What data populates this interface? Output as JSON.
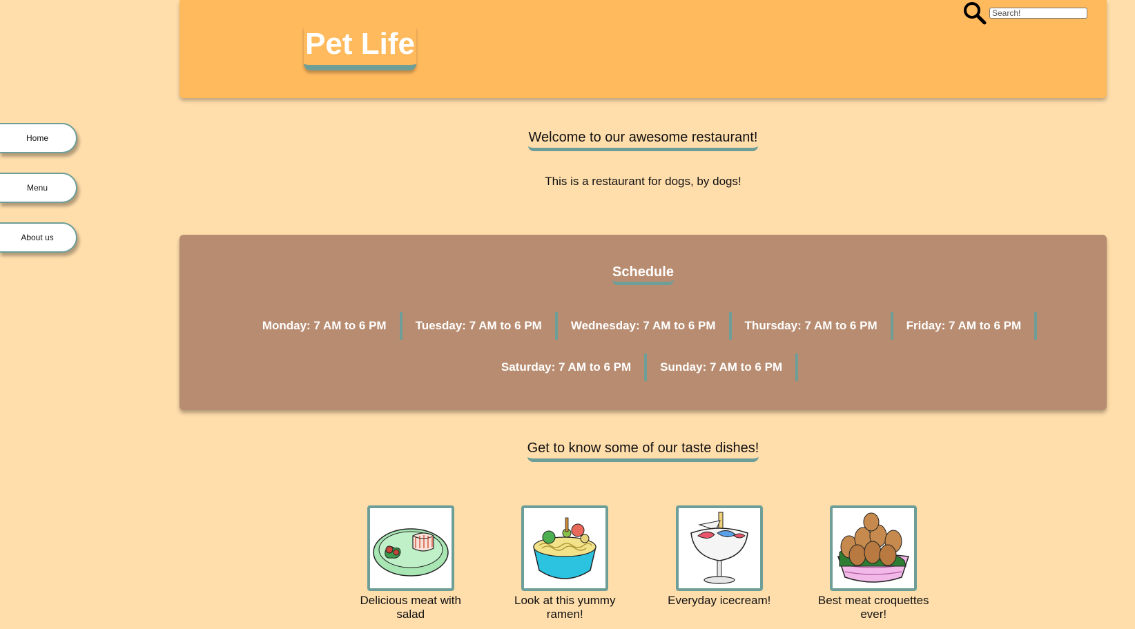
{
  "header": {
    "site_title": "Pet Life",
    "search_placeholder": "Search!",
    "search_icon": "search-icon"
  },
  "nav": {
    "items": [
      {
        "label": "Home"
      },
      {
        "label": "Menu"
      },
      {
        "label": "About us"
      }
    ]
  },
  "welcome": {
    "heading": "Welcome to our awesome restaurant!",
    "text": "This is a restaurant for dogs, by dogs!"
  },
  "schedule": {
    "title": "Schedule",
    "days": [
      "Monday: 7 AM to 6 PM",
      "Tuesday: 7 AM to 6 PM",
      "Wednesday: 7 AM to 6 PM",
      "Thursday: 7 AM to 6 PM",
      "Friday: 7 AM to 6 PM",
      "Saturday: 7 AM to 6 PM",
      "Sunday: 7 AM to 6 PM"
    ]
  },
  "dishes": {
    "heading": "Get to know some of our taste dishes!",
    "items": [
      {
        "caption": "Delicious meat with salad",
        "icon": "meat-salad-plate-icon"
      },
      {
        "caption": "Look at this yummy ramen!",
        "icon": "ramen-bowl-icon"
      },
      {
        "caption": "Everyday icecream!",
        "icon": "icecream-cup-icon"
      },
      {
        "caption": "Best meat croquettes ever!",
        "icon": "croquettes-bowl-icon"
      }
    ]
  },
  "colors": {
    "page_background": "#FFDEAC",
    "header_background": "#FFBA5E",
    "schedule_background": "#B88C70",
    "accent_teal": "#6D9E98"
  }
}
